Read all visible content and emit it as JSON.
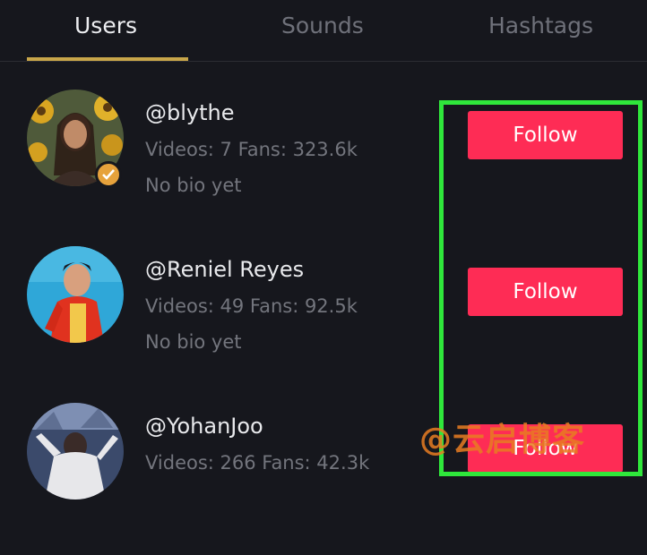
{
  "tabs": [
    {
      "label": "Users",
      "active": true
    },
    {
      "label": "Sounds",
      "active": false
    },
    {
      "label": "Hashtags",
      "active": false
    }
  ],
  "users": [
    {
      "username": "@blythe",
      "stats": "Videos: 7 Fans: 323.6k",
      "bio": "No bio yet",
      "verified": true,
      "follow_label": "Follow"
    },
    {
      "username": "@Reniel Reyes",
      "stats": "Videos: 49 Fans: 92.5k",
      "bio": "No bio yet",
      "verified": false,
      "follow_label": "Follow"
    },
    {
      "username": "@YohanJoo",
      "stats": "Videos: 266 Fans: 42.3k",
      "bio": "",
      "verified": false,
      "follow_label": "Follow"
    }
  ],
  "watermark": "@云启博客",
  "colors": {
    "background": "#16171d",
    "follow_button": "#fe2c55",
    "tab_indicator": "#c8a64a",
    "highlight_border": "#2fe73b",
    "verified_badge": "#e6a23c"
  }
}
